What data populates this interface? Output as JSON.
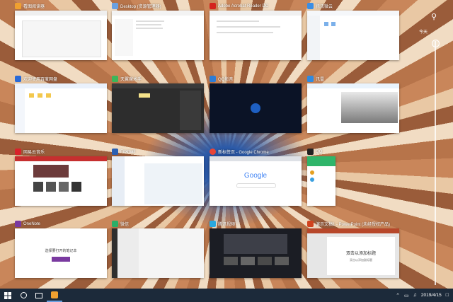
{
  "windows": [
    {
      "title": "看图阅读器",
      "icon_color": "#f0a030"
    },
    {
      "title": "Desktop (资源管理器)",
      "icon_color": "#6aa0e0"
    },
    {
      "title": "Adobe Acrobat Reader DC",
      "icon_color": "#d4231d"
    },
    {
      "title": "腾讯微云",
      "icon_color": "#3a8ee6"
    },
    {
      "title": "欢迎使用百度网盘",
      "icon_color": "#2a6ad6"
    },
    {
      "title": "天翼魔术手",
      "icon_color": "#3bb65a"
    },
    {
      "title": "QQ影音",
      "icon_color": "#2d7cd6"
    },
    {
      "title": "讯雷",
      "icon_color": "#2f8ae0"
    },
    {
      "title": "网易云音乐",
      "icon_color": "#d8222a"
    },
    {
      "title": "Foxmail",
      "icon_color": "#2a5fb3"
    },
    {
      "title": "新标签页 - Google Chrome",
      "icon_color": "#e84436"
    },
    {
      "title": "QQ",
      "icon_color": "#222222"
    },
    {
      "title": "OneNote",
      "icon_color": "#7a3aa0"
    },
    {
      "title": "微信",
      "icon_color": "#2aae67"
    },
    {
      "title": "腾讯视频",
      "icon_color": "#29a8e0"
    },
    {
      "title": "演示文稿1 - PowerPoint (未经授权产品)",
      "icon_color": "#d0431f"
    }
  ],
  "thumb_texts": {
    "google": "Google",
    "onenote_hint": "选择要打开的笔记本",
    "ppt_title": "双击以添加标题",
    "ppt_subtitle": "双击以添加副标题"
  },
  "timeline": {
    "label": "今天"
  },
  "taskbar": {
    "date": "2019/4/15"
  }
}
